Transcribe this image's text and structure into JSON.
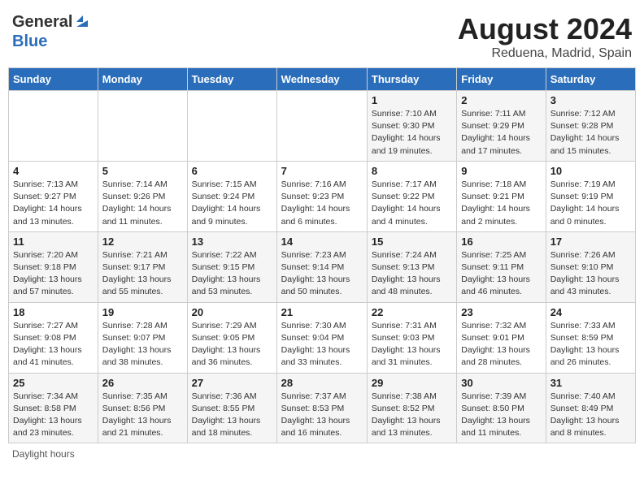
{
  "header": {
    "logo_general": "General",
    "logo_blue": "Blue",
    "month_title": "August 2024",
    "location": "Reduena, Madrid, Spain"
  },
  "weekdays": [
    "Sunday",
    "Monday",
    "Tuesday",
    "Wednesday",
    "Thursday",
    "Friday",
    "Saturday"
  ],
  "footer": "Daylight hours",
  "weeks": [
    [
      {
        "day": "",
        "info": ""
      },
      {
        "day": "",
        "info": ""
      },
      {
        "day": "",
        "info": ""
      },
      {
        "day": "",
        "info": ""
      },
      {
        "day": "1",
        "info": "Sunrise: 7:10 AM\nSunset: 9:30 PM\nDaylight: 14 hours and 19 minutes."
      },
      {
        "day": "2",
        "info": "Sunrise: 7:11 AM\nSunset: 9:29 PM\nDaylight: 14 hours and 17 minutes."
      },
      {
        "day": "3",
        "info": "Sunrise: 7:12 AM\nSunset: 9:28 PM\nDaylight: 14 hours and 15 minutes."
      }
    ],
    [
      {
        "day": "4",
        "info": "Sunrise: 7:13 AM\nSunset: 9:27 PM\nDaylight: 14 hours and 13 minutes."
      },
      {
        "day": "5",
        "info": "Sunrise: 7:14 AM\nSunset: 9:26 PM\nDaylight: 14 hours and 11 minutes."
      },
      {
        "day": "6",
        "info": "Sunrise: 7:15 AM\nSunset: 9:24 PM\nDaylight: 14 hours and 9 minutes."
      },
      {
        "day": "7",
        "info": "Sunrise: 7:16 AM\nSunset: 9:23 PM\nDaylight: 14 hours and 6 minutes."
      },
      {
        "day": "8",
        "info": "Sunrise: 7:17 AM\nSunset: 9:22 PM\nDaylight: 14 hours and 4 minutes."
      },
      {
        "day": "9",
        "info": "Sunrise: 7:18 AM\nSunset: 9:21 PM\nDaylight: 14 hours and 2 minutes."
      },
      {
        "day": "10",
        "info": "Sunrise: 7:19 AM\nSunset: 9:19 PM\nDaylight: 14 hours and 0 minutes."
      }
    ],
    [
      {
        "day": "11",
        "info": "Sunrise: 7:20 AM\nSunset: 9:18 PM\nDaylight: 13 hours and 57 minutes."
      },
      {
        "day": "12",
        "info": "Sunrise: 7:21 AM\nSunset: 9:17 PM\nDaylight: 13 hours and 55 minutes."
      },
      {
        "day": "13",
        "info": "Sunrise: 7:22 AM\nSunset: 9:15 PM\nDaylight: 13 hours and 53 minutes."
      },
      {
        "day": "14",
        "info": "Sunrise: 7:23 AM\nSunset: 9:14 PM\nDaylight: 13 hours and 50 minutes."
      },
      {
        "day": "15",
        "info": "Sunrise: 7:24 AM\nSunset: 9:13 PM\nDaylight: 13 hours and 48 minutes."
      },
      {
        "day": "16",
        "info": "Sunrise: 7:25 AM\nSunset: 9:11 PM\nDaylight: 13 hours and 46 minutes."
      },
      {
        "day": "17",
        "info": "Sunrise: 7:26 AM\nSunset: 9:10 PM\nDaylight: 13 hours and 43 minutes."
      }
    ],
    [
      {
        "day": "18",
        "info": "Sunrise: 7:27 AM\nSunset: 9:08 PM\nDaylight: 13 hours and 41 minutes."
      },
      {
        "day": "19",
        "info": "Sunrise: 7:28 AM\nSunset: 9:07 PM\nDaylight: 13 hours and 38 minutes."
      },
      {
        "day": "20",
        "info": "Sunrise: 7:29 AM\nSunset: 9:05 PM\nDaylight: 13 hours and 36 minutes."
      },
      {
        "day": "21",
        "info": "Sunrise: 7:30 AM\nSunset: 9:04 PM\nDaylight: 13 hours and 33 minutes."
      },
      {
        "day": "22",
        "info": "Sunrise: 7:31 AM\nSunset: 9:03 PM\nDaylight: 13 hours and 31 minutes."
      },
      {
        "day": "23",
        "info": "Sunrise: 7:32 AM\nSunset: 9:01 PM\nDaylight: 13 hours and 28 minutes."
      },
      {
        "day": "24",
        "info": "Sunrise: 7:33 AM\nSunset: 8:59 PM\nDaylight: 13 hours and 26 minutes."
      }
    ],
    [
      {
        "day": "25",
        "info": "Sunrise: 7:34 AM\nSunset: 8:58 PM\nDaylight: 13 hours and 23 minutes."
      },
      {
        "day": "26",
        "info": "Sunrise: 7:35 AM\nSunset: 8:56 PM\nDaylight: 13 hours and 21 minutes."
      },
      {
        "day": "27",
        "info": "Sunrise: 7:36 AM\nSunset: 8:55 PM\nDaylight: 13 hours and 18 minutes."
      },
      {
        "day": "28",
        "info": "Sunrise: 7:37 AM\nSunset: 8:53 PM\nDaylight: 13 hours and 16 minutes."
      },
      {
        "day": "29",
        "info": "Sunrise: 7:38 AM\nSunset: 8:52 PM\nDaylight: 13 hours and 13 minutes."
      },
      {
        "day": "30",
        "info": "Sunrise: 7:39 AM\nSunset: 8:50 PM\nDaylight: 13 hours and 11 minutes."
      },
      {
        "day": "31",
        "info": "Sunrise: 7:40 AM\nSunset: 8:49 PM\nDaylight: 13 hours and 8 minutes."
      }
    ]
  ]
}
